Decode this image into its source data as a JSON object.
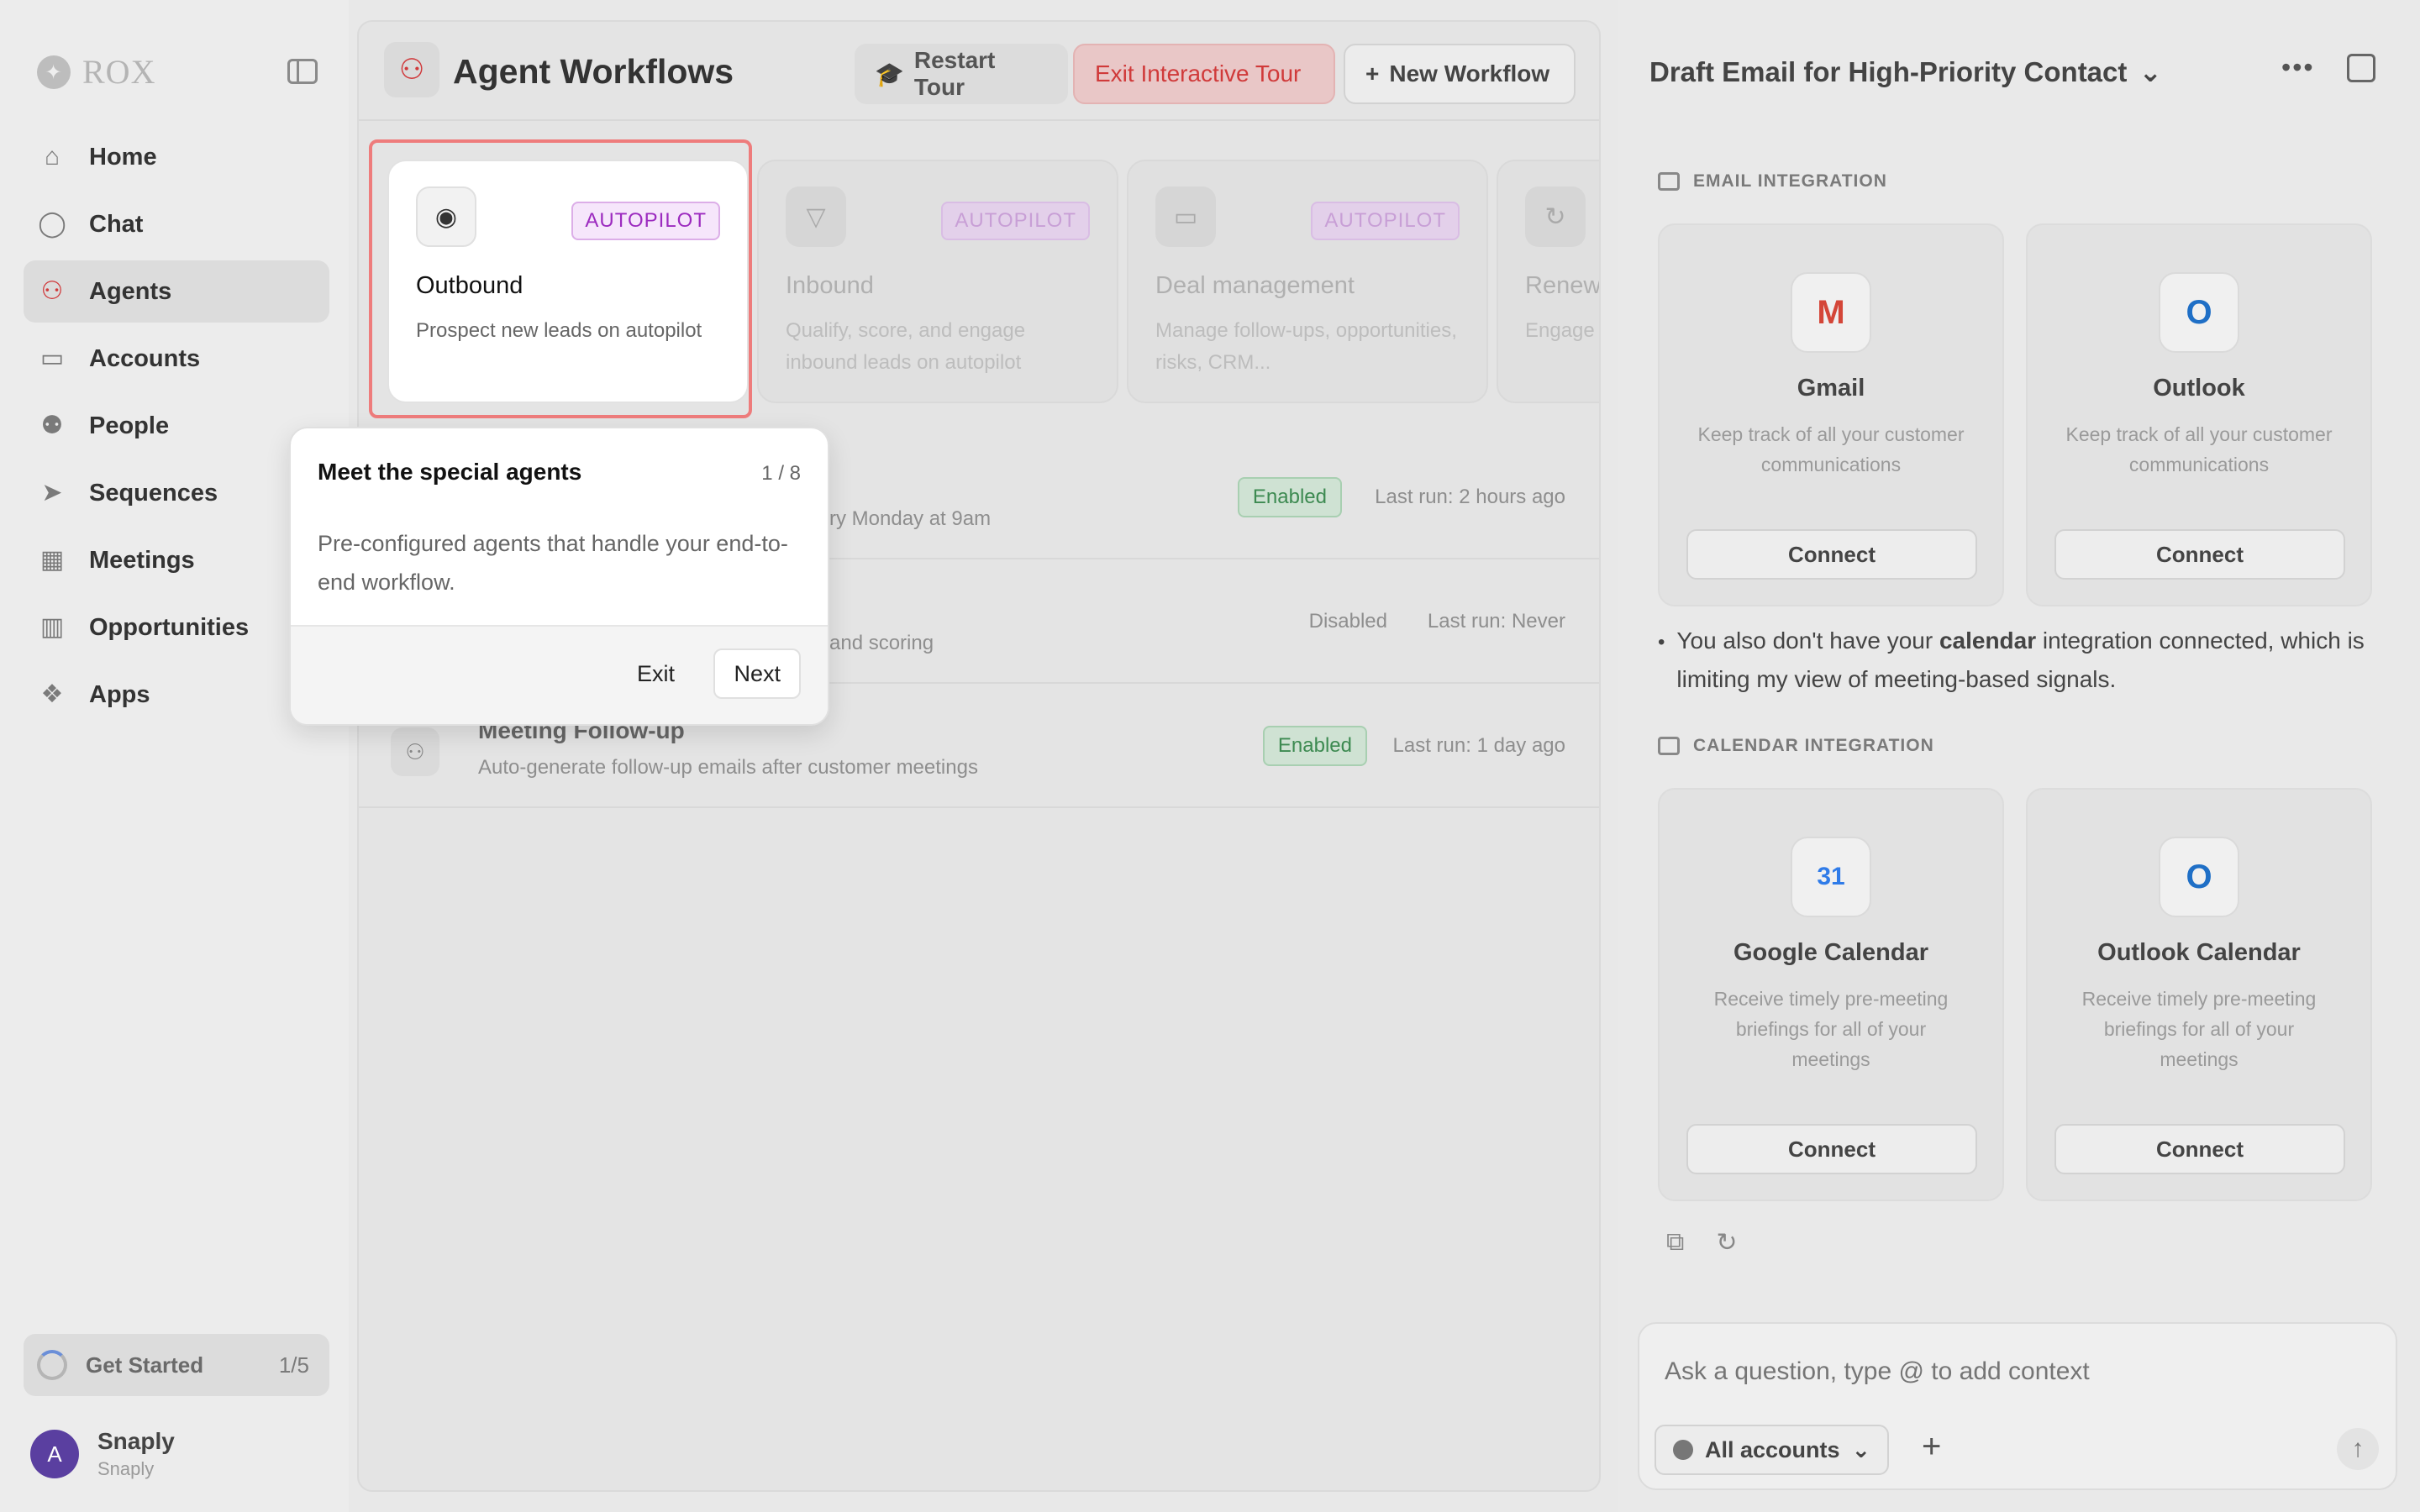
{
  "brand": {
    "name": "ROX"
  },
  "sidebar": {
    "items": [
      {
        "label": "Home",
        "icon": "home-icon",
        "glyph": "⌂"
      },
      {
        "label": "Chat",
        "icon": "chat-bubble-icon",
        "glyph": "◯"
      },
      {
        "label": "Agents",
        "icon": "agents-icon",
        "glyph": "⚇"
      },
      {
        "label": "Accounts",
        "icon": "briefcase-icon",
        "glyph": "▭"
      },
      {
        "label": "People",
        "icon": "people-icon",
        "glyph": "⚉"
      },
      {
        "label": "Sequences",
        "icon": "send-icon",
        "glyph": "➤"
      },
      {
        "label": "Meetings",
        "icon": "calendar-icon",
        "glyph": "▦"
      },
      {
        "label": "Opportunities",
        "icon": "columns-icon",
        "glyph": "▥"
      },
      {
        "label": "Apps",
        "icon": "apps-icon",
        "glyph": "❖"
      }
    ],
    "active": "Agents",
    "get_started": {
      "label": "Get Started",
      "count": "1/5"
    },
    "user": {
      "initial": "A",
      "name": "Snaply",
      "sub": "Snaply"
    }
  },
  "main": {
    "title": "Agent Workflows",
    "buttons": {
      "restart": "Restart Tour",
      "exit": "Exit Interactive Tour",
      "new": "New Workflow"
    },
    "cards": [
      {
        "title": "Outbound",
        "badge": "AUTOPILOT",
        "desc": "Prospect new leads on autopilot",
        "icon": "radar-icon"
      },
      {
        "title": "Inbound",
        "badge": "AUTOPILOT",
        "desc": "Qualify, score, and engage inbound leads on autopilot",
        "icon": "funnel-icon"
      },
      {
        "title": "Deal management",
        "badge": "AUTOPILOT",
        "desc": "Manage follow-ups, opportunities, risks, CRM...",
        "icon": "briefcase-icon"
      },
      {
        "title": "Renewa",
        "badge": "",
        "desc": "Engage of renew",
        "icon": "refresh-icon"
      }
    ],
    "workflows": [
      {
        "title": "",
        "desc": "ry Monday at 9am",
        "status": "Enabled",
        "last": "Last run: 2 hours ago"
      },
      {
        "title": "",
        "desc": "and scoring",
        "status": "Disabled",
        "last": "Last run: Never"
      },
      {
        "title": "Meeting Follow-up",
        "desc": "Auto-generate follow-up emails after customer meetings",
        "status": "Enabled",
        "last": "Last run: 1 day ago"
      }
    ]
  },
  "tour": {
    "title": "Meet the special agents",
    "step": "1 / 8",
    "body": "Pre-configured agents that handle your end-to-end workflow.",
    "exit": "Exit",
    "next": "Next"
  },
  "right": {
    "title": "Draft Email for High-Priority Contact",
    "email_section": "EMAIL INTEGRATION",
    "calendar_section": "CALENDAR INTEGRATION",
    "email_cards": [
      {
        "name": "Gmail",
        "desc": "Keep track of all your customer communications",
        "connect": "Connect",
        "logo": "M",
        "color": "#d44638"
      },
      {
        "name": "Outlook",
        "desc": "Keep track of all your customer communications",
        "connect": "Connect",
        "logo": "O",
        "color": "#1f6fc6"
      }
    ],
    "calendar_cards": [
      {
        "name": "Google Calendar",
        "desc": "Receive timely pre-meeting briefings for all of your meetings",
        "connect": "Connect",
        "logo": "31",
        "color": "#2f7be8"
      },
      {
        "name": "Outlook Calendar",
        "desc": "Receive timely pre-meeting briefings for all of your meetings",
        "connect": "Connect",
        "logo": "O",
        "color": "#1f6fc6"
      }
    ],
    "bullet": {
      "pre": "You also don't have your ",
      "bold": "calendar",
      "post": " integration connected, which is limiting my view of meeting-based signals."
    },
    "composer": {
      "placeholder": "Ask a question, type @ to add context",
      "accounts": "All accounts"
    }
  }
}
